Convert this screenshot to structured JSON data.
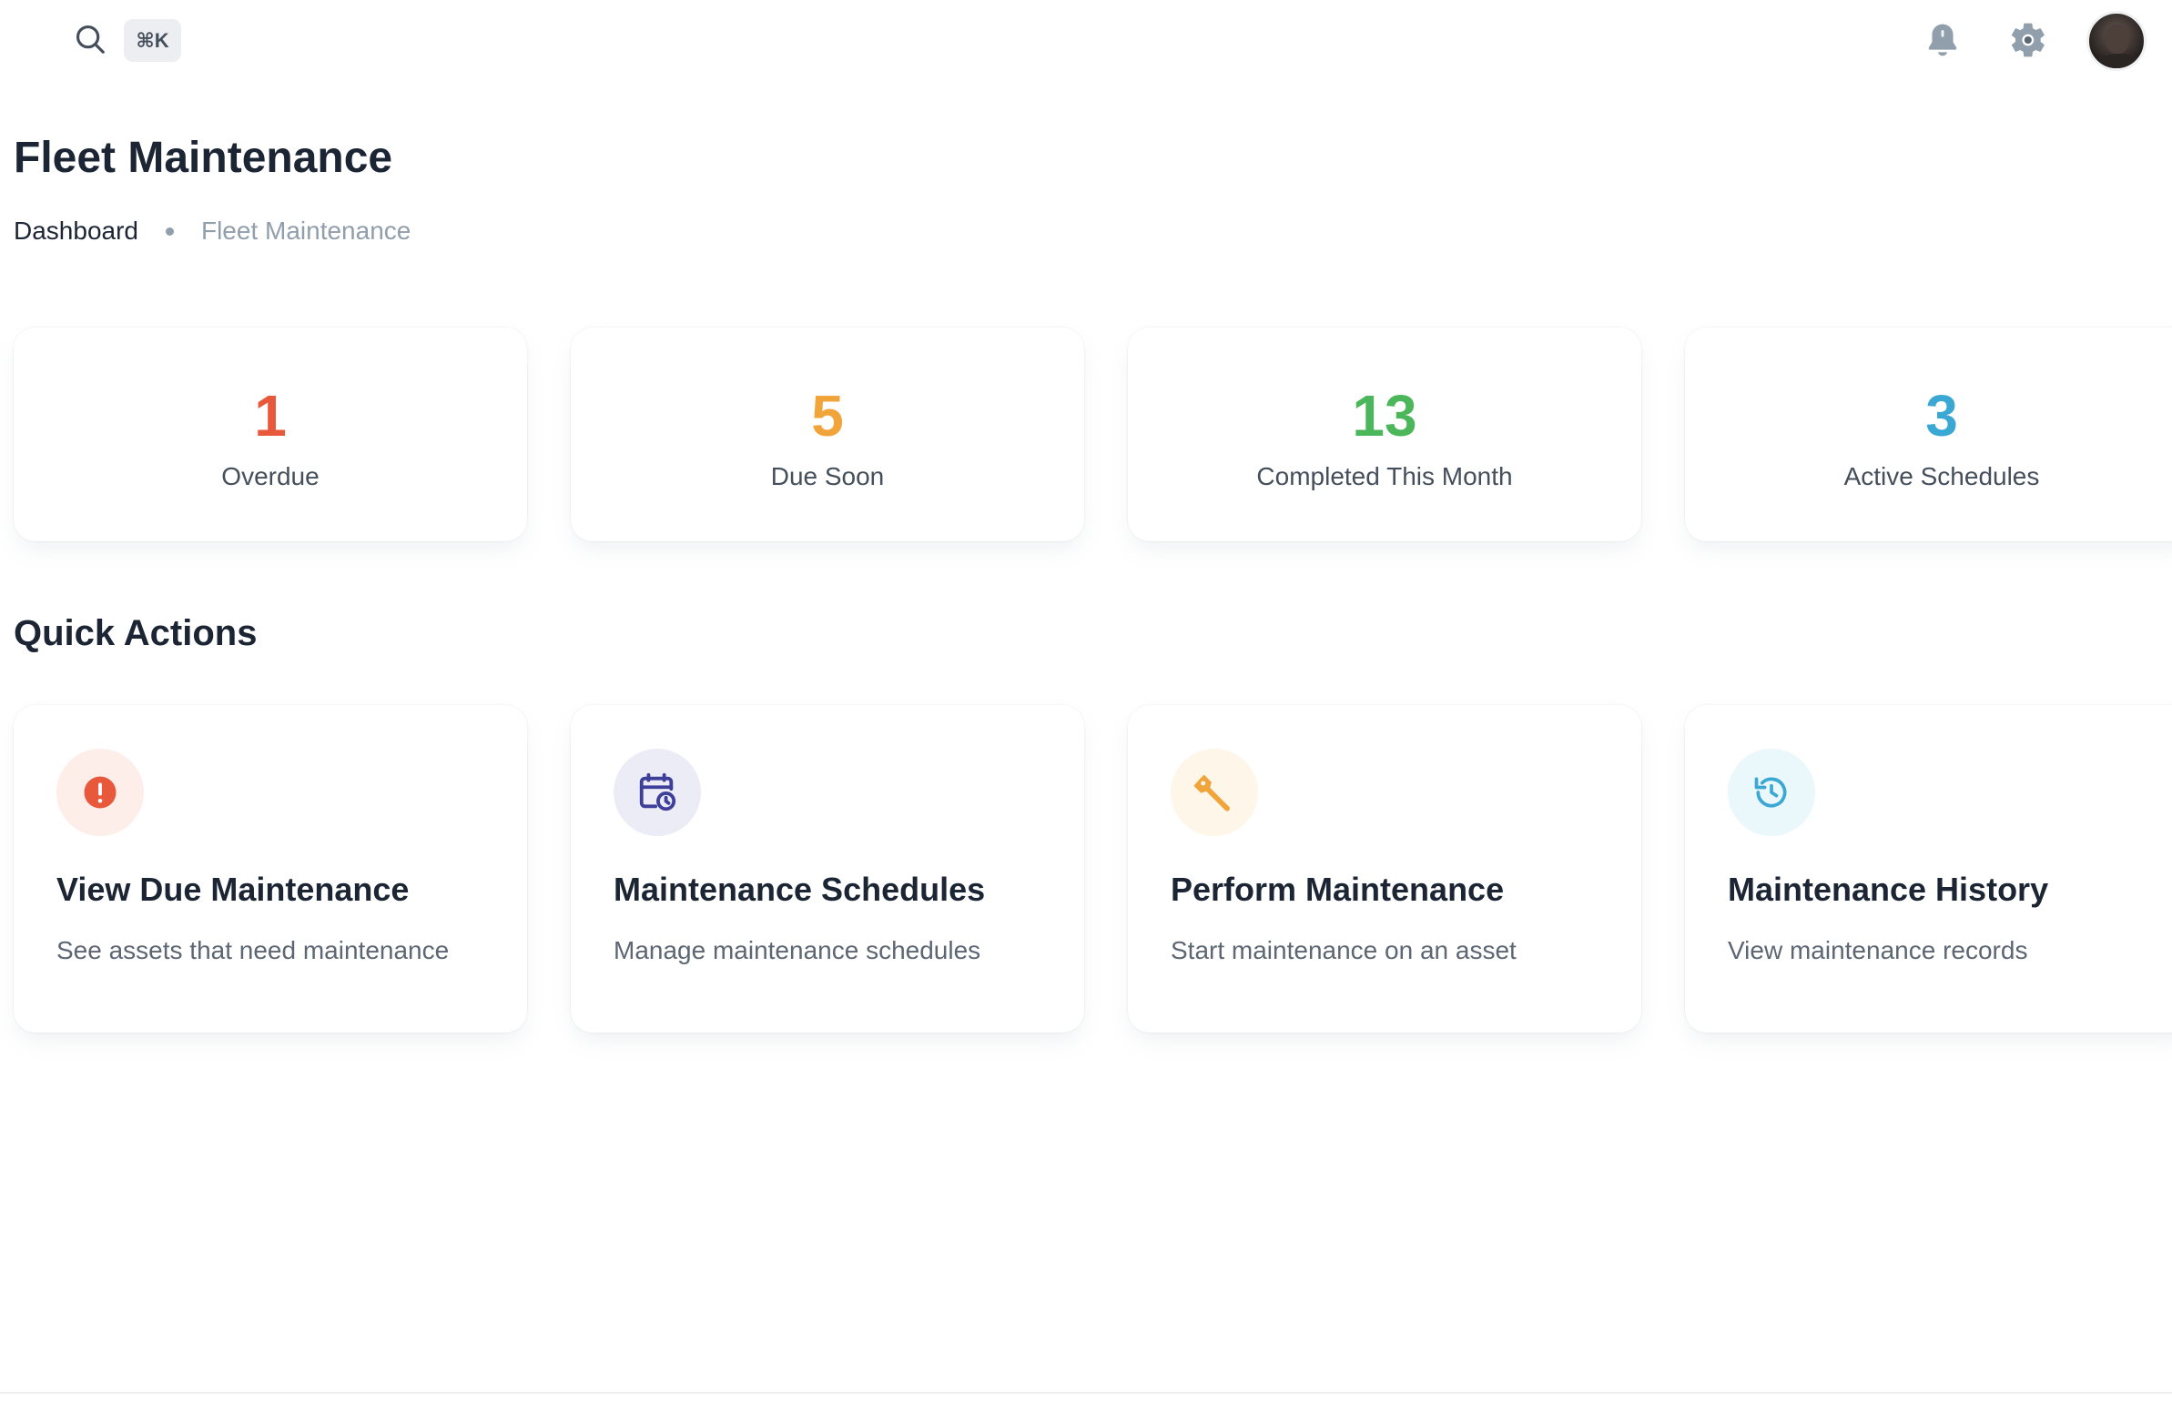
{
  "topbar": {
    "shortcut": "⌘K",
    "icons": [
      "search-icon",
      "bell-icon",
      "gear-icon",
      "avatar"
    ]
  },
  "header": {
    "title": "Fleet Maintenance",
    "breadcrumb": [
      "Dashboard",
      "Fleet Maintenance"
    ]
  },
  "stats": [
    {
      "value": "1",
      "label": "Overdue",
      "color": "#e8583a"
    },
    {
      "value": "5",
      "label": "Due Soon",
      "color": "#f0a43a"
    },
    {
      "value": "13",
      "label": "Completed This Month",
      "color": "#4cb65a"
    },
    {
      "value": "3",
      "label": "Active Schedules",
      "color": "#3ba8d4"
    }
  ],
  "quick_actions": {
    "title": "Quick Actions",
    "items": [
      {
        "title": "View Due Maintenance",
        "description": "See assets that need maintenance",
        "icon": "alert-circle-icon",
        "color": "#e8583a",
        "bg": "#fdeeea"
      },
      {
        "title": "Maintenance Schedules",
        "description": "Manage maintenance schedules",
        "icon": "calendar-clock-icon",
        "color": "#3e3f99",
        "bg": "#ececf6"
      },
      {
        "title": "Perform Maintenance",
        "description": "Start maintenance on an asset",
        "icon": "wrench-icon",
        "color": "#f0a43a",
        "bg": "#fef6e8"
      },
      {
        "title": "Maintenance History",
        "description": "View maintenance records",
        "icon": "history-icon",
        "color": "#3ba8d4",
        "bg": "#eaf7fb"
      }
    ]
  }
}
